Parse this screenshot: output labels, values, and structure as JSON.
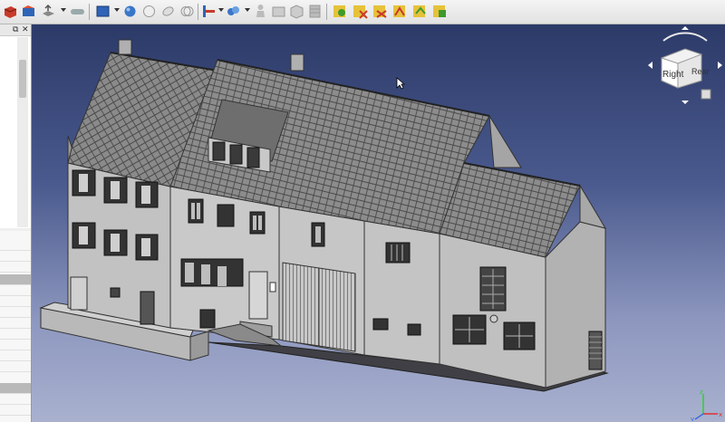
{
  "toolbar": {
    "icons": [
      "part-box-icon",
      "part-cylinder-icon",
      "extrude-icon",
      "fillet-icon",
      "view-menu-icon",
      "sphere-icon",
      "cylinder-icon",
      "cone-icon",
      "torus-icon",
      "measure-icon",
      "link-icon",
      "person-icon",
      "box-icon",
      "cube-icon",
      "tube-icon",
      "check-geometry-icon",
      "section-icon",
      "boolean-icon",
      "union-icon",
      "cut-icon"
    ],
    "colors": {
      "accent_blue": "#2f64b8",
      "accent_green": "#3e9a2e",
      "accent_red": "#c83a2a",
      "accent_yellow": "#e6c23a"
    }
  },
  "left_panel": {
    "float_label": "⧉",
    "close_label": "✕"
  },
  "viewport": {
    "background_top": "#2c3a68",
    "background_bottom": "#a9b1cf",
    "model": "3d-house-model"
  },
  "navcube": {
    "face_right": "Right",
    "face_rear": "Rear"
  },
  "axis": {
    "x": "x",
    "y": "y",
    "z": "z"
  }
}
